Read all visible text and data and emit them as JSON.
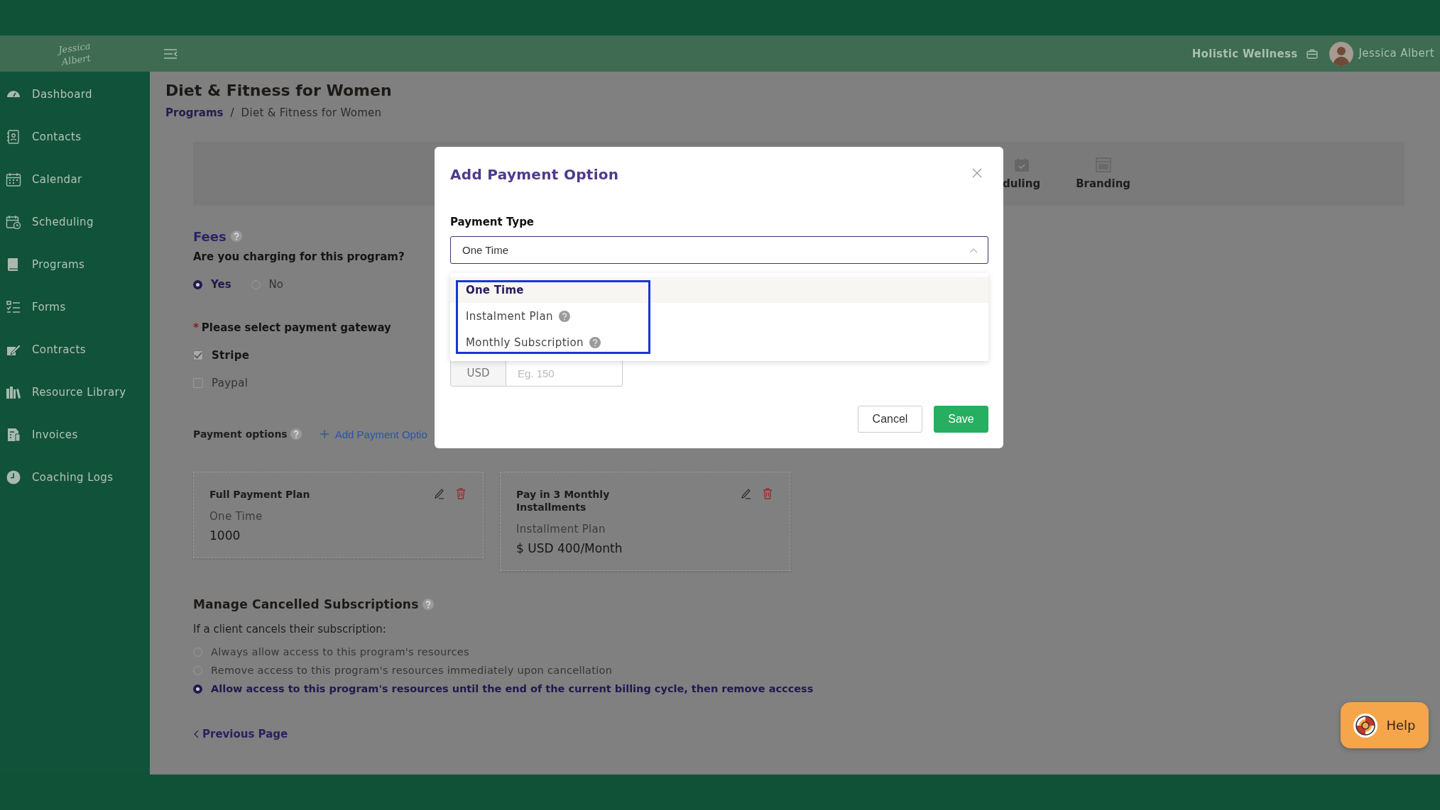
{
  "header": {
    "logo": "Jessica Albert",
    "workspace": "Holistic Wellness",
    "user": "Jessica Albert"
  },
  "sidebar": {
    "items": [
      {
        "label": "Dashboard"
      },
      {
        "label": "Contacts"
      },
      {
        "label": "Calendar"
      },
      {
        "label": "Scheduling"
      },
      {
        "label": "Programs"
      },
      {
        "label": "Forms"
      },
      {
        "label": "Contracts"
      },
      {
        "label": "Resource Library"
      },
      {
        "label": "Invoices"
      },
      {
        "label": "Coaching Logs"
      }
    ]
  },
  "page": {
    "title": "Diet & Fitness for Women",
    "breadcrumb": [
      {
        "label": "Programs"
      },
      {
        "label": "Diet & Fitness for Women"
      }
    ],
    "breadcrumb_separator": "/"
  },
  "tabs": [
    {
      "label": "duling"
    },
    {
      "label": "Branding"
    }
  ],
  "fees": {
    "heading": "Fees",
    "question": "Are you charging for this program?",
    "options": [
      {
        "label": "Yes",
        "selected": true
      },
      {
        "label": "No",
        "selected": false
      }
    ],
    "required_mark": "*",
    "gateway_label": "Please select payment gateway",
    "gateways": [
      {
        "label": "Stripe",
        "checked": true
      },
      {
        "label": "Paypal",
        "checked": false
      }
    ],
    "payment_options_label": "Payment options",
    "add_link": "Add Payment Optio"
  },
  "cards": [
    {
      "title": "Full Payment Plan",
      "type": "One Time",
      "amount": "1000"
    },
    {
      "title": "Pay in 3 Monthly Installments",
      "type": "Installment Plan",
      "amount": "$ USD 400/Month"
    }
  ],
  "cancellation": {
    "heading": "Manage Cancelled Subscriptions",
    "prompt": "If a client cancels their subscription:",
    "options": [
      {
        "label": "Always allow access to this program's resources",
        "selected": false
      },
      {
        "label": "Remove access to this program's resources immediately upon cancellation",
        "selected": false
      },
      {
        "label": "Allow access to this program's resources until the end of the current billing cycle, then remove acccess",
        "selected": true
      }
    ]
  },
  "previous_page": "Previous Page",
  "modal": {
    "title": "Add Payment Option",
    "field_label": "Payment Type",
    "value": "One Time",
    "dropdown": [
      {
        "label": "One Time",
        "selected": true,
        "help": false
      },
      {
        "label": "Instalment Plan",
        "selected": false,
        "help": true
      },
      {
        "label": "Monthly Subscription",
        "selected": false,
        "help": true
      }
    ],
    "currency": "USD",
    "amount_placeholder": "Eg. 150",
    "buttons": [
      {
        "label": "Cancel",
        "kind": "secondary"
      },
      {
        "label": "Save",
        "kind": "primary"
      }
    ]
  },
  "help": "Help"
}
